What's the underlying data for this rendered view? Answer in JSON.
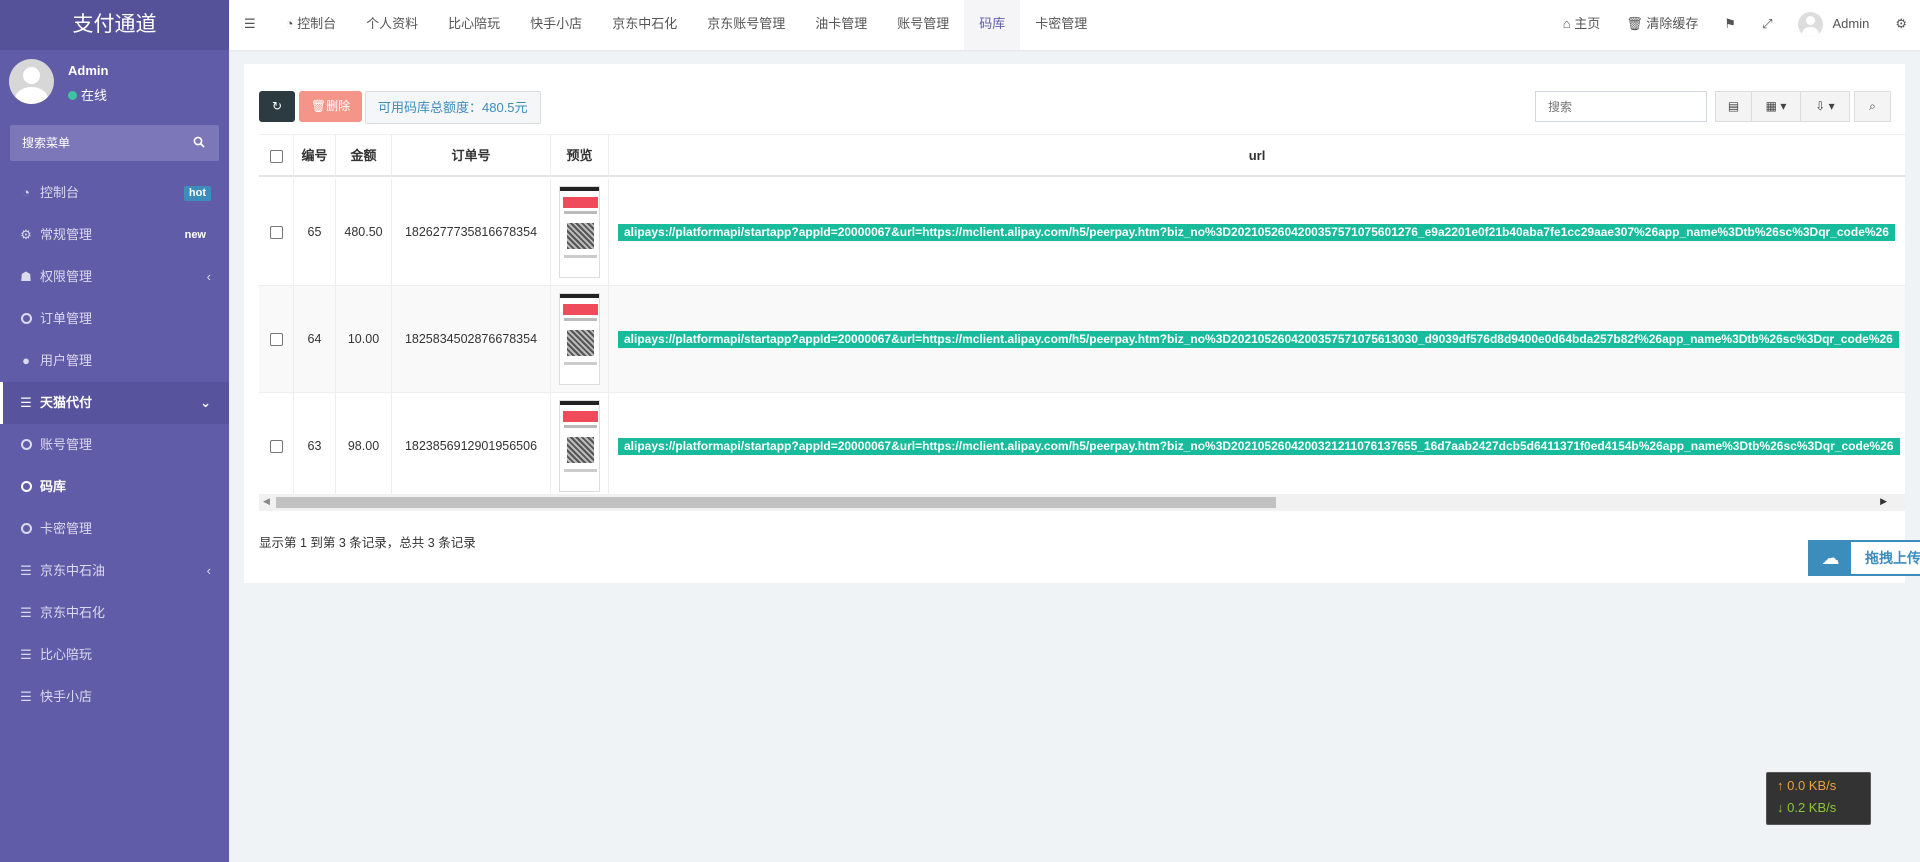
{
  "sidebar": {
    "logo": "支付通道",
    "user_name": "Admin",
    "user_status": "在线",
    "search_placeholder": "搜索菜单",
    "items": [
      {
        "label": "控制台",
        "badge": "hot"
      },
      {
        "label": "常规管理",
        "badge": "new"
      },
      {
        "label": "权限管理"
      },
      {
        "label": "订单管理"
      },
      {
        "label": "用户管理"
      },
      {
        "label": "天猫代付"
      },
      {
        "label": "账号管理"
      },
      {
        "label": "码库"
      },
      {
        "label": "卡密管理"
      },
      {
        "label": "京东中石油"
      },
      {
        "label": "京东中石化"
      },
      {
        "label": "比心陪玩"
      },
      {
        "label": "快手小店"
      }
    ]
  },
  "topbar": {
    "tabs": [
      "控制台",
      "个人资料",
      "比心陪玩",
      "快手小店",
      "京东中石化",
      "京东账号管理",
      "油卡管理",
      "账号管理",
      "码库",
      "卡密管理"
    ],
    "active_tab": "码库",
    "home": "主页",
    "clear_cache": "清除缓存",
    "user": "Admin"
  },
  "toolbar": {
    "delete_label": "删除",
    "quota_text": "可用码库总额度：480.5元",
    "search_placeholder": "搜索"
  },
  "table": {
    "columns": [
      "编号",
      "金额",
      "订单号",
      "预览",
      "url"
    ],
    "rows": [
      {
        "id": "65",
        "amount": "480.50",
        "order_no": "1826277735816678354",
        "url": "alipays://platformapi/startapp?appId=20000067&url=https://mclient.alipay.com/h5/peerpay.htm?biz_no%3D2021052604200357571075601276_e9a2201e0f21b40aba7fe1cc29aae307%26app_name%3Dtb%26sc%3Dqr_code%26"
      },
      {
        "id": "64",
        "amount": "10.00",
        "order_no": "1825834502876678354",
        "url": "alipays://platformapi/startapp?appId=20000067&url=https://mclient.alipay.com/h5/peerpay.htm?biz_no%3D2021052604200357571075613030_d9039df576d8d9400e0d64bda257b82f%26app_name%3Dtb%26sc%3Dqr_code%26"
      },
      {
        "id": "63",
        "amount": "98.00",
        "order_no": "1823856912901956506",
        "url": "alipays://platformapi/startapp?appId=20000067&url=https://mclient.alipay.com/h5/peerpay.htm?biz_no%3D2021052604200321211076137655_16d7aab2427dcb5d6411371f0ed4154b%26app_name%3Dtb%26sc%3Dqr_code%26"
      }
    ]
  },
  "pagination_info": "显示第 1 到第 3 条记录，总共 3 条记录",
  "upload_label": "拖拽上传",
  "network": {
    "up": "0.0 KB/s",
    "down": "0.2 KB/s"
  },
  "colors": {
    "sidebar": "#605ca8",
    "accent": "#18bc9c",
    "primary": "#3c8dbc",
    "danger": "#f5958a"
  }
}
